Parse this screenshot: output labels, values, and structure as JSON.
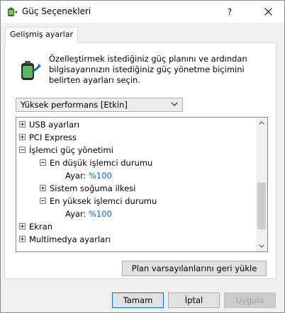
{
  "window": {
    "title": "Güç Seçenekleri",
    "help_label": "?",
    "close_label": "✕"
  },
  "tabs": [
    {
      "label": "Gelişmiş ayarlar",
      "selected": true
    }
  ],
  "description": "Özelleştirmek istediğiniz güç planını ve ardından bilgisayarınızın istediğiniz güç yönetme biçimini belirten ayarları seçin.",
  "plan_select": {
    "selected": "Yüksek performans [Etkin]"
  },
  "tree": [
    {
      "level": 0,
      "expander": "+",
      "label": "USB ayarları"
    },
    {
      "level": 0,
      "expander": "+",
      "label": "PCI Express"
    },
    {
      "level": 0,
      "expander": "-",
      "label": "İşlemci güç yönetimi"
    },
    {
      "level": 1,
      "expander": "-",
      "label": "En düşük işlemci durumu"
    },
    {
      "level": 2,
      "label": "Ayar:",
      "value": "%100"
    },
    {
      "level": 1,
      "expander": "+",
      "label": "Sistem soğuma ilkesi"
    },
    {
      "level": 1,
      "expander": "-",
      "label": "En yüksek işlemci durumu"
    },
    {
      "level": 2,
      "label": "Ayar:",
      "value": "%100"
    },
    {
      "level": 0,
      "expander": "+",
      "label": "Ekran"
    },
    {
      "level": 0,
      "expander": "+",
      "label": "Multimedya ayarları"
    }
  ],
  "buttons": {
    "restore": "Plan varsayılanlarını geri yükle",
    "ok": "Tamam",
    "cancel": "İptal",
    "apply": "Uygula"
  },
  "colors": {
    "link_value": "#0066cc",
    "focus_border": "#0078d7"
  },
  "icons": {
    "app": "power-options-icon",
    "battery": "battery-power-icon"
  }
}
